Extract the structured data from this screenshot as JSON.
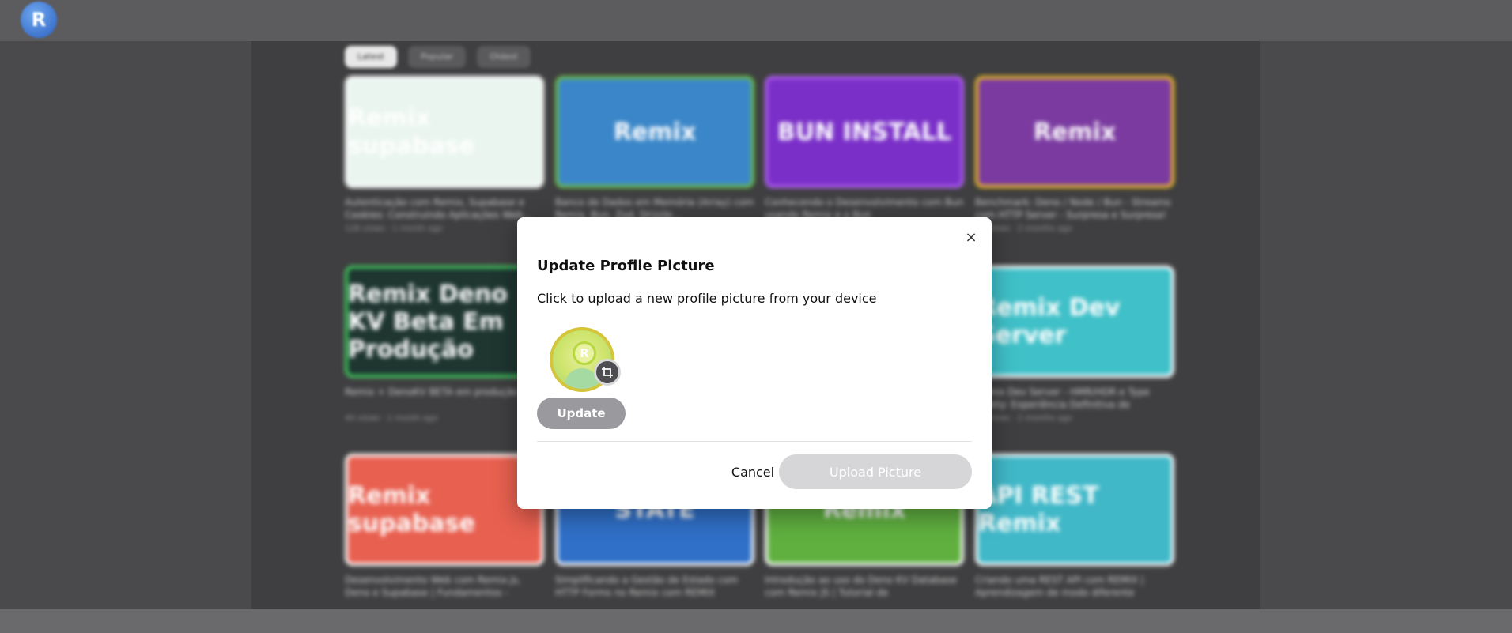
{
  "app": {
    "logo_letter": "R"
  },
  "filters": [
    "Latest",
    "Popular",
    "Oldest"
  ],
  "cards": [
    {
      "thumb_text": "Remix supabase",
      "color": "#e9f5ee",
      "border": "#ffffff",
      "title": "Autenticação com Remix, Supabase e Cookies: Construindo Aplicações Web...",
      "meta": "128 views · 1 month ago"
    },
    {
      "thumb_text": "Remix",
      "color": "#3a86c8",
      "border": "#6ec248",
      "title": "Banco de Dados em Memória (Array) com Remix, Bun, Zod, Drizzle...",
      "meta": ""
    },
    {
      "thumb_text": "BUN INSTALL",
      "color": "#7a2fc8",
      "border": "#b060f0",
      "title": "Conhecendo o Desenvolvimento com Bun usando Remix e o Bun",
      "meta": ""
    },
    {
      "thumb_text": "Remix",
      "color": "#7a3aa0",
      "border": "#f0c020",
      "title": "Benchmark: Deno / Node / Bun - Streams com HTTP Server - Surpresa e Surpresa!",
      "meta": "68 views · 2 months ago"
    },
    {
      "thumb_text": "Remix Deno KV Beta Em Produção",
      "color": "#1e3530",
      "border": "#40d060",
      "title": "Remix + DenoKV BETA em produção",
      "meta": "40 views · 1 month ago"
    },
    {
      "thumb_text": "",
      "color": "#3c3c3e",
      "border": "#3c3c3e",
      "title": "",
      "meta": ""
    },
    {
      "thumb_text": "",
      "color": "#3c3c3e",
      "border": "#3c3c3e",
      "title": "",
      "meta": ""
    },
    {
      "thumb_text": "Remix Dev Server",
      "color": "#40c0c8",
      "border": "#ffffff",
      "title": "Remix Dev Server - HMR/HDR e Type Safety: Experiência Definitiva de Desenvolvimento",
      "meta": "88 views · 2 months ago"
    },
    {
      "thumb_text": "Remix supabase",
      "color": "#e86050",
      "border": "#ffffff",
      "title": "Desenvolvimento Web com Remix.js, Deno e Supabase | Fundamentos - Implantação no...",
      "meta": ""
    },
    {
      "thumb_text": "STATE",
      "color": "#3070c8",
      "border": "#ffffff",
      "title": "Simplificando a Gestão de Estado com HTTP Forms no Remix com REMIX",
      "meta": ""
    },
    {
      "thumb_text": "Remix",
      "color": "#60b040",
      "border": "#ffffff",
      "title": "Introdução ao uso do Deno KV Database com Remix JS | Tutorial de Desenvolvimento",
      "meta": ""
    },
    {
      "thumb_text": "API REST Remix",
      "color": "#40b8c8",
      "border": "#ffffff",
      "title": "Criando uma REST API com REMIX | Aprendizagem de modo diferente",
      "meta": ""
    }
  ],
  "modal": {
    "title": "Update Profile Picture",
    "description": "Click to upload a new profile picture from your device",
    "avatar_letter": "R",
    "update_label": "Update",
    "cancel_label": "Cancel",
    "upload_label": "Upload Picture",
    "close_glyph": "×"
  },
  "colors": {
    "overlay": "#4a4a4c",
    "update_button": "#9a9a9e",
    "upload_button_disabled": "#d6d6d8",
    "avatar_ring": "#d4c53a"
  },
  "icons": {
    "close": "close-icon",
    "crop": "crop-icon",
    "logo": "remix-logo-icon"
  }
}
